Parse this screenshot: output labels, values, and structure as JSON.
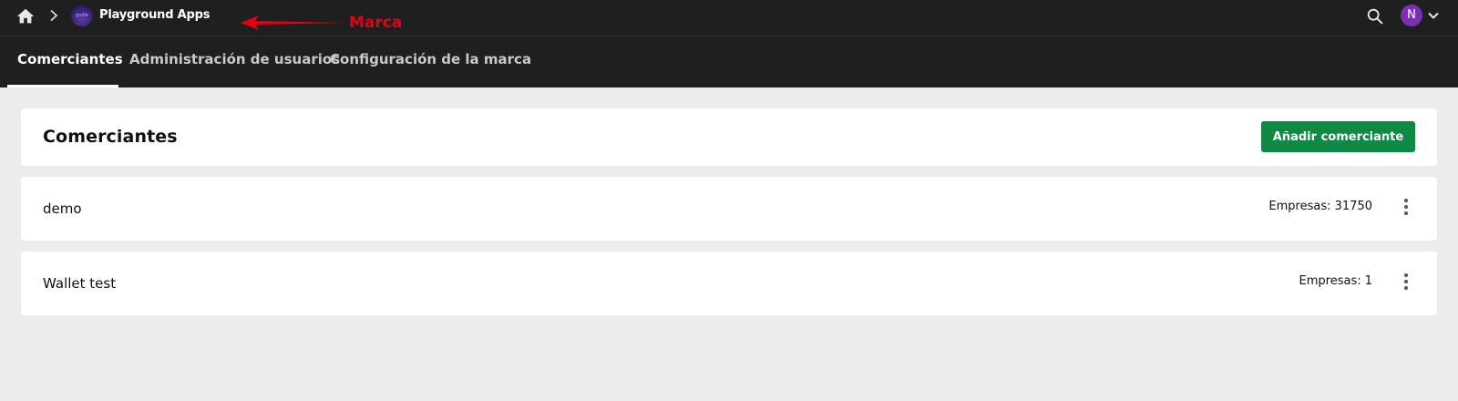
{
  "topbar": {
    "app_name": "Playground Apps",
    "logo_text": "gndle",
    "annotation_label": "Marca",
    "avatar_initial": "N",
    "icons": [
      "home-icon",
      "chevron-right-icon",
      "search-icon",
      "chevron-down-icon"
    ]
  },
  "tabs": [
    {
      "label": "Comerciantes",
      "active": true
    },
    {
      "label": "Administración de usuarios",
      "active": false
    },
    {
      "label": "Configuración de la marca",
      "active": false
    }
  ],
  "main": {
    "title": "Comerciantes",
    "add_button_label": "Añadir comerciante",
    "merchants": [
      {
        "name": "demo",
        "companies": "Empresas: 31750"
      },
      {
        "name": "Wallet test",
        "companies": "Empresas: 1"
      }
    ]
  },
  "colors": {
    "topbar_bg": "#1f1f20",
    "page_bg": "#ececee",
    "primary_button": "#0e8a44",
    "avatar": "#7b2fb5",
    "annotation": "#e60012"
  }
}
